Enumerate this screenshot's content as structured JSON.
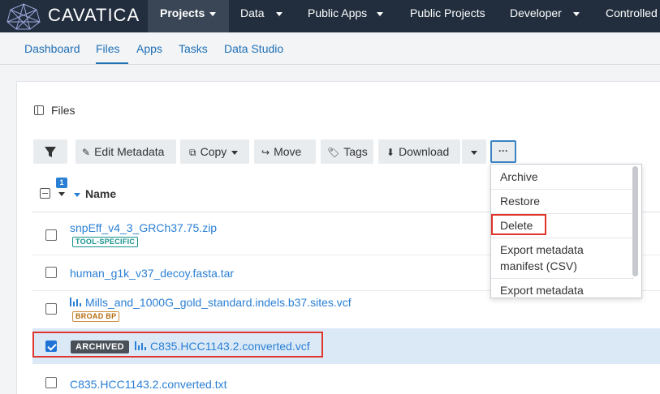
{
  "app": {
    "logo_text": "CAVATICA"
  },
  "topnav": [
    {
      "label": "Projects",
      "dropdown": true
    },
    {
      "label": "Data",
      "dropdown": true
    },
    {
      "label": "Public Apps",
      "dropdown": true
    },
    {
      "label": "Public Projects",
      "dropdown": false
    },
    {
      "label": "Developer",
      "dropdown": true
    },
    {
      "label": "Controlled",
      "dropdown": false
    }
  ],
  "subnav": [
    "Dashboard",
    "Files",
    "Apps",
    "Tasks",
    "Data Studio"
  ],
  "files_title": "Files",
  "toolbar": {
    "edit_metadata": "Edit Metadata",
    "copy": "Copy",
    "move": "Move",
    "tags": "Tags",
    "download": "Download",
    "more": "···"
  },
  "table": {
    "selected_count": "1",
    "name_header": "Name",
    "rows": [
      {
        "name": "snpEff_v4_3_GRCh37.75.zip",
        "tag": "TOOL-SPECIFIC",
        "checked": false
      },
      {
        "name": "human_g1k_v37_decoy.fasta.tar",
        "checked": false
      },
      {
        "name": "Mills_and_1000G_gold_standard.indels.b37.sites.vcf",
        "tag": "BROAD BP",
        "checked": false
      },
      {
        "name": "C835.HCC1143.2.converted.vcf",
        "status": "ARCHIVED",
        "checked": true
      },
      {
        "name": "C835.HCC1143.2.converted.txt",
        "checked": false
      }
    ]
  },
  "dropdown": {
    "items": [
      "Archive",
      "Restore",
      "Delete",
      "Export metadata manifest (CSV)",
      "Export metadata"
    ],
    "manifest_line1": "Export metadata",
    "manifest_line2": "manifest (CSV)"
  },
  "colors": {
    "nav_bg": "#222e3e",
    "link": "#2a7fd4",
    "highlight_border": "#e0352b"
  }
}
